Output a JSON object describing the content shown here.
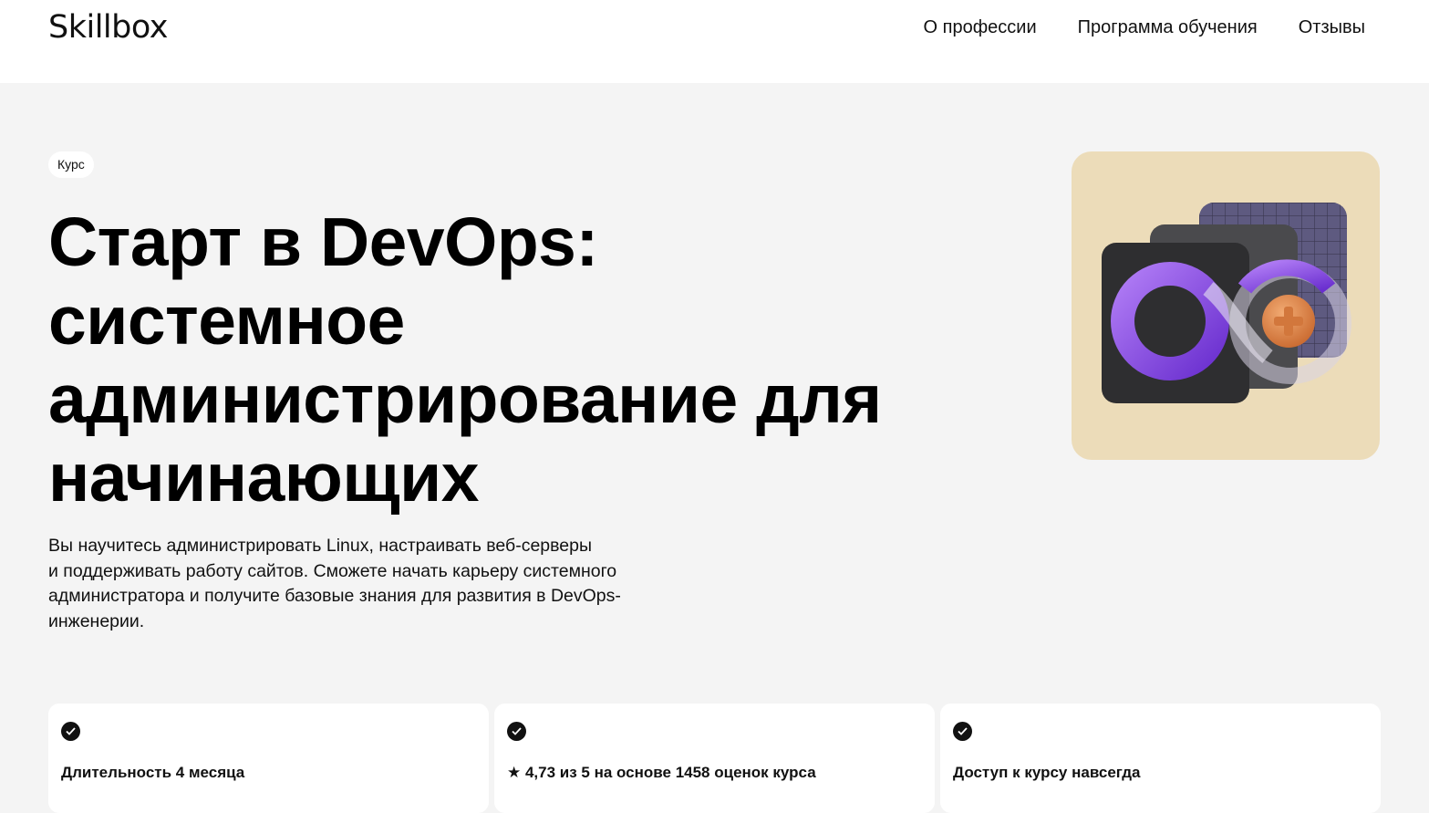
{
  "header": {
    "logo": "Skillbox",
    "nav": [
      {
        "label": "О профессии"
      },
      {
        "label": "Программа обучения"
      },
      {
        "label": "Отзывы"
      }
    ]
  },
  "hero": {
    "badge": "Курс",
    "title_lines": [
      "Старт в DevOps:",
      "системное",
      "администрирование для",
      "начинающих"
    ],
    "description_lines": [
      "Вы научитесь администрировать Linux, настраивать веб-серверы",
      "и поддерживать работу сайтов. Сможете начать карьеру системного",
      "администратора и получите базовые знания для развития в DevOps-",
      "инженерии."
    ],
    "image_icon": "devops-infinity-icon"
  },
  "features": [
    {
      "icon": "check-circle-icon",
      "text": "Длительность 4 месяца"
    },
    {
      "icon": "check-circle-icon",
      "text": "★ 4,73 из 5 на основе 1458 оценок курса"
    },
    {
      "icon": "check-circle-icon",
      "text": "Доступ к курсу навсегда"
    }
  ],
  "colors": {
    "page_bg": "#f4f4f4",
    "image_bg": "#ecdcb9",
    "accent_purple": "#8a4fe0",
    "accent_orange": "#e0894a"
  }
}
